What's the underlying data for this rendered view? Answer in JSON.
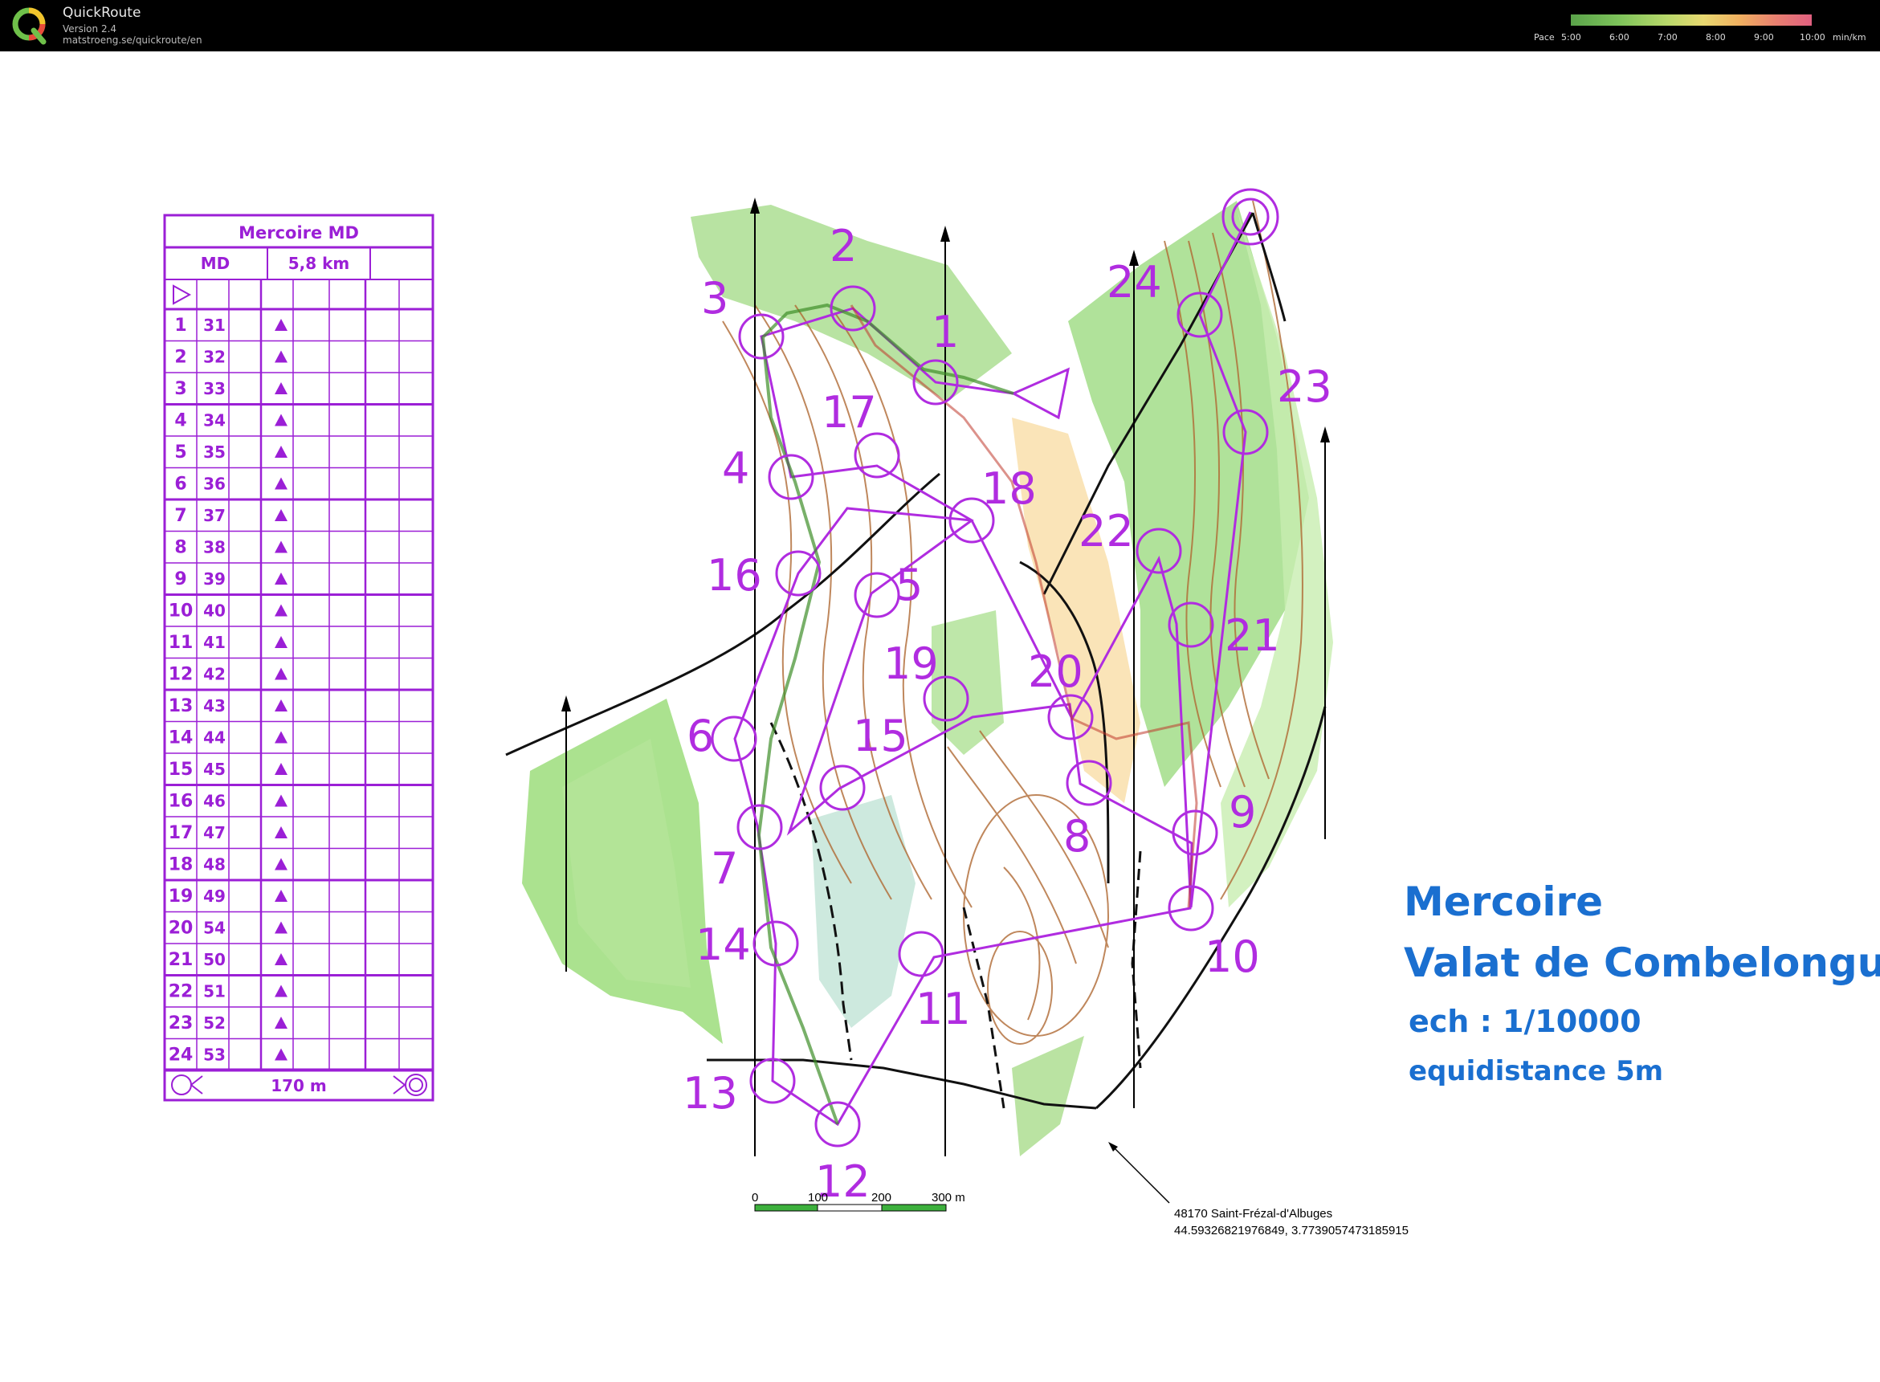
{
  "app": {
    "title": "QuickRoute",
    "version": "Version 2.4",
    "url": "matstroeng.se/quickroute/en"
  },
  "pace_legend": {
    "label": "Pace",
    "ticks": [
      "5:00",
      "6:00",
      "7:00",
      "8:00",
      "9:00",
      "10:00"
    ],
    "unit": "min/km"
  },
  "control_descriptions": {
    "title": "Mercoire MD",
    "class": "MD",
    "length": "5,8 km",
    "footer_distance": "170 m",
    "rows": [
      {
        "n": "1",
        "code": "31"
      },
      {
        "n": "2",
        "code": "32"
      },
      {
        "n": "3",
        "code": "33"
      },
      {
        "n": "4",
        "code": "34"
      },
      {
        "n": "5",
        "code": "35"
      },
      {
        "n": "6",
        "code": "36"
      },
      {
        "n": "7",
        "code": "37"
      },
      {
        "n": "8",
        "code": "38"
      },
      {
        "n": "9",
        "code": "39"
      },
      {
        "n": "10",
        "code": "40"
      },
      {
        "n": "11",
        "code": "41"
      },
      {
        "n": "12",
        "code": "42"
      },
      {
        "n": "13",
        "code": "43"
      },
      {
        "n": "14",
        "code": "44"
      },
      {
        "n": "15",
        "code": "45"
      },
      {
        "n": "16",
        "code": "46"
      },
      {
        "n": "17",
        "code": "47"
      },
      {
        "n": "18",
        "code": "48"
      },
      {
        "n": "19",
        "code": "49"
      },
      {
        "n": "20",
        "code": "54"
      },
      {
        "n": "21",
        "code": "50"
      },
      {
        "n": "22",
        "code": "51"
      },
      {
        "n": "23",
        "code": "52"
      },
      {
        "n": "24",
        "code": "53"
      }
    ]
  },
  "control_numbers": [
    "1",
    "2",
    "3",
    "4",
    "5",
    "6",
    "7",
    "8",
    "9",
    "10",
    "11",
    "12",
    "13",
    "14",
    "15",
    "16",
    "17",
    "18",
    "19",
    "20",
    "21",
    "22",
    "23",
    "24"
  ],
  "map_title": {
    "line1": "Mercoire",
    "line2": "Valat de Combelongue",
    "line3": "ech : 1/10000",
    "line4": "equidistance 5m"
  },
  "scale_bar": {
    "labels": [
      "0",
      "100",
      "200",
      "300 m"
    ]
  },
  "location": {
    "address": "48170 Saint-Frézal-d'Albuges",
    "coords": "44.59326821976849, 3.7739057473185915"
  },
  "colors": {
    "course": "#b02ce0",
    "title_blue": "#1a6fd0",
    "forest_green": "#5fc03c",
    "contour": "#a0522d"
  }
}
